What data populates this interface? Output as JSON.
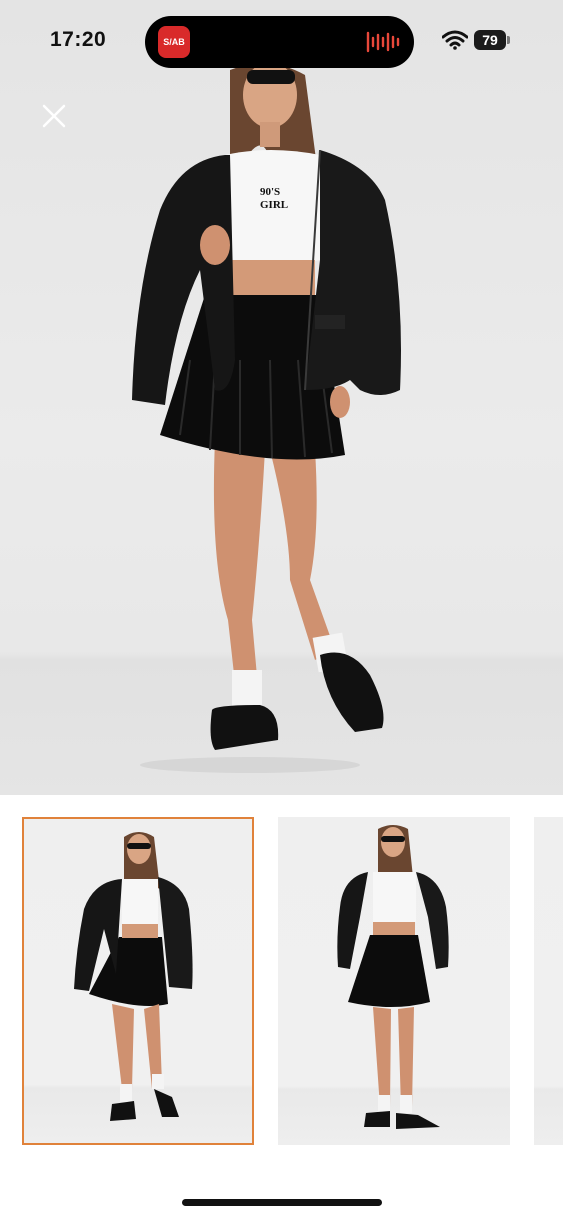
{
  "status_bar": {
    "time": "17:20",
    "app_badge": "S/AB",
    "battery": "79",
    "icons": [
      "wifi-icon",
      "battery-icon",
      "audio-wave-icon"
    ]
  },
  "viewer": {
    "close_icon": "close-icon",
    "main_image": "product-photo-model-leather-jacket",
    "shirt_text": "90's GIRL"
  },
  "thumbnails": {
    "selected_index": 0,
    "accent": "#e0823a",
    "items": [
      "thumbnail-1",
      "thumbnail-2",
      "thumbnail-3"
    ]
  }
}
